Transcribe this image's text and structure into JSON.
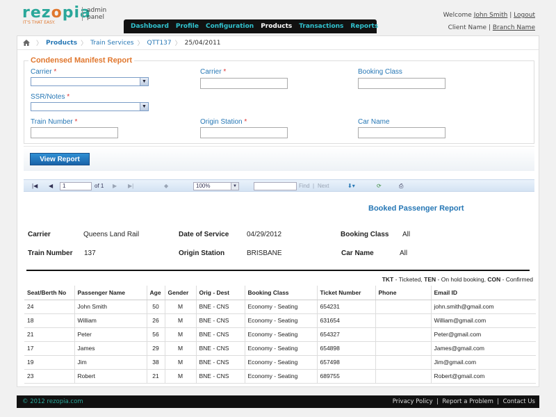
{
  "brand": {
    "logo_a": "rez",
    "logo_o": "o",
    "logo_b": "pia",
    "tagline": "IT'S THAT EASY.",
    "panel_line1": "admin",
    "panel_line2": "panel"
  },
  "nav": {
    "items": [
      "Dashboard",
      "Profile",
      "Configuration",
      "Products",
      "Transactions",
      "Reports"
    ],
    "active": "Products"
  },
  "welcome": {
    "prefix": "Welcome",
    "user": "John Smith",
    "sep": "|",
    "logout": "Logout",
    "client": "Client Name",
    "branch": "Branch Name"
  },
  "breadcrumb": {
    "items": [
      "Products",
      "Train Services",
      "QTT137",
      "25/04/2011"
    ]
  },
  "form": {
    "title": "Condensed Manifest Report",
    "carrier_label": "Carrier",
    "carrier2_label": "Carrier",
    "booking_class_label": "Booking Class",
    "ssr_label": "SSR/Notes",
    "train_number_label": "Train Number",
    "origin_station_label": "Origin Station",
    "car_name_label": "Car Name",
    "required_mark": "*",
    "view_report": "View Report"
  },
  "toolbar": {
    "page": "1",
    "of": "of 1",
    "zoom": "100%",
    "find": "Find",
    "next": "Next",
    "sep": "|"
  },
  "report": {
    "title": "Booked Passenger Report",
    "carrier_label": "Carrier",
    "carrier_value": "Queens Land Rail",
    "date_label": "Date of Service",
    "date_value": "04/29/2012",
    "class_label": "Booking Class",
    "class_value": "All",
    "train_label": "Train Number",
    "train_value": "137",
    "origin_label": "Origin Station",
    "origin_value": "BRISBANE",
    "car_label": "Car Name",
    "car_value": "All",
    "legend": {
      "tkt": "TKT",
      "tkt_desc": " - Ticketed, ",
      "ten": "TEN",
      "ten_desc": " - On hold booking, ",
      "con": "CON",
      "con_desc": " - Confirmed"
    }
  },
  "table": {
    "headers": [
      "Seat/Berth No",
      "Passenger Name",
      "Age",
      "Gender",
      "Orig - Dest",
      "Booking Class",
      "Ticket Number",
      "Phone",
      "Email ID"
    ],
    "rows": [
      [
        "24",
        "John Smith",
        "50",
        "M",
        "BNE - CNS",
        "Economy - Seating",
        "654231",
        "",
        "john.smith@gmail.com"
      ],
      [
        "18",
        "William",
        "26",
        "M",
        "BNE - CNS",
        "Economy - Seating",
        "631654",
        "",
        "William@gmail.com"
      ],
      [
        "21",
        "Peter",
        "56",
        "M",
        "BNE - CNS",
        "Economy - Seating",
        "654327",
        "",
        "Peter@gmail.com"
      ],
      [
        "17",
        "James",
        "29",
        "M",
        "BNE - CNS",
        "Economy - Seating",
        "654898",
        "",
        "James@gmail.com"
      ],
      [
        "19",
        "Jim",
        "38",
        "M",
        "BNE - CNS",
        "Economy - Seating",
        "657498",
        "",
        "Jim@gmail.com"
      ],
      [
        "23",
        "Robert",
        "21",
        "M",
        "BNE - CNS",
        "Economy - Seating",
        "689755",
        "",
        "Robert@gmail.com"
      ]
    ]
  },
  "footer": {
    "copyright": "© 2012 rezopia.com",
    "privacy": "Privacy Policy",
    "problem": "Report a Problem",
    "contact": "Contact Us",
    "sep": "|"
  },
  "colors": {
    "brand_teal": "#2aa79a",
    "brand_orange": "#e0772e",
    "link_blue": "#2677b5",
    "nav_bg": "#111111",
    "button_blue": "#1a63a8"
  }
}
